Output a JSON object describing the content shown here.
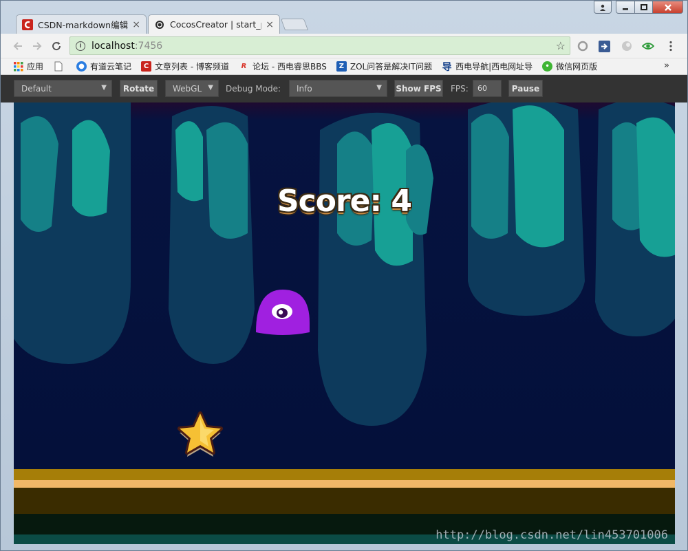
{
  "browser": {
    "tabs": [
      {
        "label": "CSDN-markdown编辑器",
        "close": "×"
      },
      {
        "label": "CocosCreator | start_p",
        "close": "×"
      }
    ],
    "address": {
      "host": "localhost",
      "port": ":7456"
    },
    "bookmarks": [
      {
        "label": "应用",
        "color": "#e64a19"
      },
      {
        "label": "",
        "color": "#ffffff"
      },
      {
        "label": "有道云笔记",
        "color": "#2a7de1"
      },
      {
        "label": "文章列表 - 博客频道",
        "color": "#c9241c"
      },
      {
        "label": "论坛 - 西电睿思BBS",
        "color": "#d9362b"
      },
      {
        "label": "ZOL问答是解决IT问题",
        "color": "#1f5fb5"
      },
      {
        "label": "西电导航|西电网址导",
        "color": "#13408a"
      },
      {
        "label": "微信网页版",
        "color": "#3fb534"
      }
    ],
    "more": "»"
  },
  "cocos_toolbar": {
    "device": "Default",
    "rotate": "Rotate",
    "renderer": "WebGL",
    "debug_label": "Debug Mode:",
    "debug_value": "Info",
    "show_fps": "Show FPS",
    "fps_label": "FPS:",
    "fps_value": "60",
    "pause": "Pause"
  },
  "game": {
    "score_text": "Score: 4",
    "colors": {
      "sky": "#051040",
      "pillar_outer": "#0d3a5c",
      "pillar_inner": "#157a82",
      "pillar_core": "#17a095",
      "monster": "#a020e0",
      "star": "#f6c034",
      "ground_top": "#a67e08",
      "ground_stripe": "#f0b867",
      "ground_mid": "#3a2c00"
    }
  },
  "watermark": "http://blog.csdn.net/lin453701006"
}
